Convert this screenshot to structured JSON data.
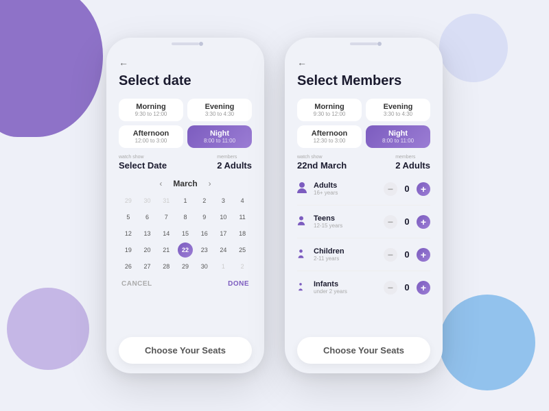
{
  "background": {
    "color": "#eef0f8"
  },
  "phone_left": {
    "title": "Select date",
    "back_label": "←",
    "time_slots": [
      {
        "id": "morning",
        "label": "Morning",
        "time": "9:30 to 12:00",
        "active": false
      },
      {
        "id": "evening",
        "label": "Evening",
        "time": "3:30 to 4:30",
        "active": false
      },
      {
        "id": "afternoon",
        "label": "Afternoon",
        "time": "12:00 to 3:00",
        "active": false
      },
      {
        "id": "night",
        "label": "Night",
        "time": "8:00 to 11:00",
        "active": true
      }
    ],
    "watch_show_label": "watch show",
    "watch_show_value": "Select Date",
    "members_label": "Members",
    "members_value": "2 Adults",
    "calendar": {
      "prev_arrow": "‹",
      "next_arrow": "›",
      "month": "March",
      "weeks": [
        [
          "29",
          "30",
          "31",
          "1",
          "2",
          "3",
          "4"
        ],
        [
          "5",
          "6",
          "7",
          "8",
          "9",
          "10",
          "11"
        ],
        [
          "12",
          "13",
          "14",
          "15",
          "16",
          "17",
          "18"
        ],
        [
          "19",
          "20",
          "21",
          "22",
          "23",
          "24",
          "25"
        ],
        [
          "26",
          "27",
          "28",
          "29",
          "30",
          "1",
          "2"
        ]
      ],
      "selected_day": "22",
      "prev_month_days": [
        "29",
        "30",
        "31"
      ],
      "next_month_days": [
        "1",
        "2"
      ]
    },
    "cancel_label": "CANCEL",
    "done_label": "DONE",
    "choose_seats_label": "Choose Your Seats"
  },
  "phone_right": {
    "title": "Select Members",
    "back_label": "←",
    "time_slots": [
      {
        "id": "morning",
        "label": "Morning",
        "time": "9:30 to 12:00",
        "active": false
      },
      {
        "id": "evening",
        "label": "Evening",
        "time": "3:30 to 4:30",
        "active": false
      },
      {
        "id": "afternoon",
        "label": "Afternoon",
        "time": "12:30 to 3:00",
        "active": false
      },
      {
        "id": "night",
        "label": "Night",
        "time": "8:00 to 11:00",
        "active": true
      }
    ],
    "watch_show_label": "watch show",
    "watch_show_value": "22nd March",
    "members_label": "Members",
    "members_value": "2 Adults",
    "members": [
      {
        "id": "adults",
        "icon": "👤",
        "name": "Adults",
        "age": "16+ years",
        "count": 0
      },
      {
        "id": "teens",
        "icon": "👤",
        "name": "Teens",
        "age": "12-15 years",
        "count": 0
      },
      {
        "id": "children",
        "icon": "👤",
        "name": "Children",
        "age": "2-11 years",
        "count": 0
      },
      {
        "id": "infants",
        "icon": "👤",
        "name": "Infants",
        "age": "under 2 years",
        "count": 0
      }
    ],
    "choose_seats_label": "Choose Your Seats"
  }
}
